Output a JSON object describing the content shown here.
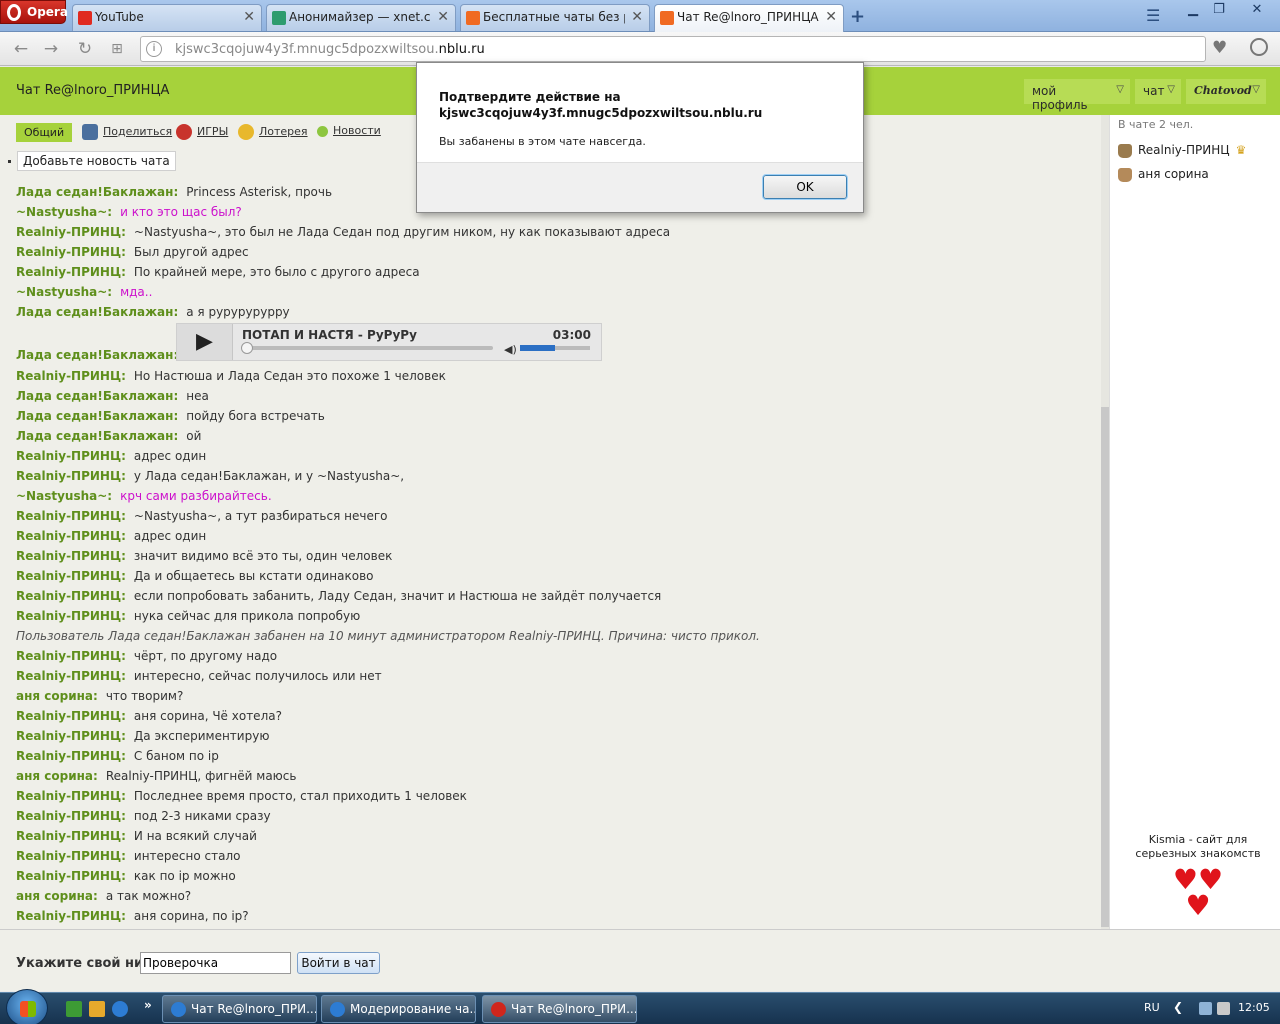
{
  "browser": {
    "menu_label": "Opera",
    "tabs": [
      {
        "title": "YouTube",
        "icon": "youtube-icon"
      },
      {
        "title": "Анонимайзер — xnet.club",
        "icon": "anonymizer-icon"
      },
      {
        "title": "Бесплатные чаты без регистрации",
        "icon": "chatovod-icon"
      },
      {
        "title": "Чат Re@lnoro_ПРИНЦА",
        "icon": "chatovod-icon"
      }
    ],
    "url_prefix": "kjswc3cqojuw4y3f.mnugc5dpozxwiltsou.",
    "url_host": "nblu.ru"
  },
  "chat": {
    "title": "Чат Re@lnoro_ПРИНЦА",
    "menus": [
      "мой профиль",
      "чат",
      "Chatovod"
    ],
    "links": [
      "Общий",
      "Поделиться",
      "ИГРЫ",
      "Лотерея",
      "Новости"
    ],
    "add_news": "Добавьте новость чата",
    "messages": [
      {
        "nick": "Лада седан!Баклажан:",
        "text": "Princess Asterisk, прочь"
      },
      {
        "nick": "~Nastyusha~:",
        "text": "и кто это щас был?",
        "pink": true
      },
      {
        "nick": "Realniy-ПРИНЦ:",
        "text": "~Nastyusha~, это был не Лада Седан под другим ником, ну как показывают адреса"
      },
      {
        "nick": "Realniy-ПРИНЦ:",
        "text": "Был другой адрес"
      },
      {
        "nick": "Realniy-ПРИНЦ:",
        "text": "По крайней мере, это было с другого адреса"
      },
      {
        "nick": "~Nastyusha~:",
        "text": "мда..",
        "pink": true
      },
      {
        "nick": "Лада седан!Баклажан:",
        "text": "а я рурурурурру"
      },
      {
        "nick": "Лада седан!Баклажан:",
        "player": true
      },
      {
        "nick": "Realniy-ПРИНЦ:",
        "text": "Но Настюша и Лада Седан это похоже 1 человек"
      },
      {
        "nick": "Лада седан!Баклажан:",
        "text": "неа"
      },
      {
        "nick": "Лада седан!Баклажан:",
        "text": "пойду бога встречать"
      },
      {
        "nick": "Лада седан!Баклажан:",
        "text": "ой"
      },
      {
        "nick": "Realniy-ПРИНЦ:",
        "text": "адрес один"
      },
      {
        "nick": "Realniy-ПРИНЦ:",
        "text": "у Лада седан!Баклажан, и у ~Nastyusha~,"
      },
      {
        "nick": "~Nastyusha~:",
        "text": "крч сами разбирайтесь.",
        "pink": true
      },
      {
        "nick": "Realniy-ПРИНЦ:",
        "text": "~Nastyusha~, а тут разбираться нечего"
      },
      {
        "nick": "Realniy-ПРИНЦ:",
        "text": "адрес один"
      },
      {
        "nick": "Realniy-ПРИНЦ:",
        "text": "значит видимо всё это ты, один человек"
      },
      {
        "nick": "Realniy-ПРИНЦ:",
        "text": "Да и общаетесь вы кстати одинаково"
      },
      {
        "nick": "Realniy-ПРИНЦ:",
        "text": "если попробовать забанить, Ладу Седан, значит и Настюша не зайдёт получается"
      },
      {
        "nick": "Realniy-ПРИНЦ:",
        "text": "нука сейчас для прикола попробую"
      },
      {
        "system": true,
        "text": "Пользователь Лада седан!Баклажан забанен на 10 минут администратором Realniy-ПРИНЦ. Причина: чисто прикол."
      },
      {
        "nick": "Realniy-ПРИНЦ:",
        "text": "чёрт, по другому надо"
      },
      {
        "nick": "Realniy-ПРИНЦ:",
        "text": "интересно, сейчас получилось или нет"
      },
      {
        "nick": "аня сорина:",
        "text": "что творим?"
      },
      {
        "nick": "Realniy-ПРИНЦ:",
        "text": "аня сорина, Чё хотела?"
      },
      {
        "nick": "Realniy-ПРИНЦ:",
        "text": "Да экспериментирую"
      },
      {
        "nick": "Realniy-ПРИНЦ:",
        "text": "С баном по ip"
      },
      {
        "nick": "аня сорина:",
        "text": "Realniy-ПРИНЦ, фигнёй маюсь"
      },
      {
        "nick": "Realniy-ПРИНЦ:",
        "text": "Последнее время просто, стал приходить 1 человек"
      },
      {
        "nick": "Realniy-ПРИНЦ:",
        "text": "под 2-3 никами сразу"
      },
      {
        "nick": "Realniy-ПРИНЦ:",
        "text": "И на всякий случай"
      },
      {
        "nick": "Realniy-ПРИНЦ:",
        "text": "интересно стало"
      },
      {
        "nick": "Realniy-ПРИНЦ:",
        "text": "как по ip можно"
      },
      {
        "nick": "аня сорина:",
        "text": "а так можно?"
      },
      {
        "nick": "Realniy-ПРИНЦ:",
        "text": "аня сорина, по ip?"
      }
    ],
    "player": {
      "track": "ПОТАП И НАСТЯ - РуРуРу",
      "duration": "03:00",
      "progress": 0,
      "volume": 0.5
    },
    "online_count": "В чате 2 чел.",
    "users": [
      {
        "name": "Realniy-ПРИНЦ",
        "admin": true
      },
      {
        "name": "аня сорина",
        "admin": false
      }
    ],
    "ad_text": "Kismia - сайт для серьезных знакомств",
    "nick_label": "Укажите свой ник:",
    "nick_value": "Проверочка",
    "enter_button": "Войти в чат"
  },
  "dialog": {
    "title": "Подтвердите действие на kjswc3cqojuw4y3f.mnugc5dpozxwiltsou.nblu.ru",
    "message": "Вы забанены в этом чате навсегда.",
    "ok": "OK"
  },
  "taskbar": {
    "tasks": [
      "Чат Re@lnoro_ПРИ...",
      "Модерирование ча...",
      "Чат Re@lnoro_ПРИ..."
    ],
    "lang": "RU",
    "time": "12:05"
  },
  "colors": {
    "nick": "#5f8f1c",
    "pink_text": "#cc11cc",
    "header_green": "#a6d23b"
  }
}
